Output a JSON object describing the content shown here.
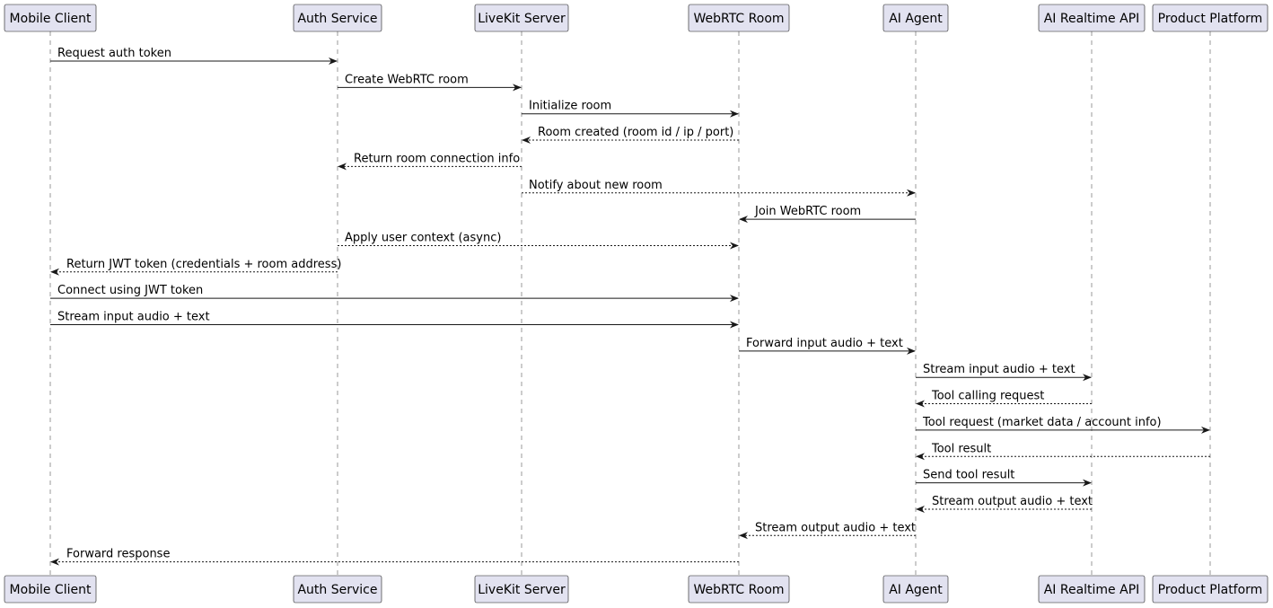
{
  "participants": [
    {
      "id": "mobile",
      "label": "Mobile Client"
    },
    {
      "id": "auth",
      "label": "Auth Service"
    },
    {
      "id": "livekit",
      "label": "LiveKit Server"
    },
    {
      "id": "webrtc",
      "label": "WebRTC Room"
    },
    {
      "id": "agent",
      "label": "AI Agent"
    },
    {
      "id": "realtime",
      "label": "AI Realtime API"
    },
    {
      "id": "product",
      "label": "Product Platform"
    }
  ],
  "messages": [
    {
      "from": "mobile",
      "to": "auth",
      "label": "Request auth token",
      "style": "solid"
    },
    {
      "from": "auth",
      "to": "livekit",
      "label": "Create WebRTC room",
      "style": "solid"
    },
    {
      "from": "livekit",
      "to": "webrtc",
      "label": "Initialize room",
      "style": "solid"
    },
    {
      "from": "webrtc",
      "to": "livekit",
      "label": "Room created (room id / ip / port)",
      "style": "dashed"
    },
    {
      "from": "livekit",
      "to": "auth",
      "label": "Return room connection info",
      "style": "dashed"
    },
    {
      "from": "livekit",
      "to": "agent",
      "label": "Notify about new room",
      "style": "dashed"
    },
    {
      "from": "agent",
      "to": "webrtc",
      "label": "Join WebRTC room",
      "style": "solid"
    },
    {
      "from": "auth",
      "to": "webrtc",
      "label": "Apply user context (async)",
      "style": "dashed"
    },
    {
      "from": "auth",
      "to": "mobile",
      "label": "Return JWT token (credentials + room address)",
      "style": "dashed"
    },
    {
      "from": "mobile",
      "to": "webrtc",
      "label": "Connect using JWT token",
      "style": "solid"
    },
    {
      "from": "mobile",
      "to": "webrtc",
      "label": "Stream input audio + text",
      "style": "solid"
    },
    {
      "from": "webrtc",
      "to": "agent",
      "label": "Forward input audio + text",
      "style": "solid"
    },
    {
      "from": "agent",
      "to": "realtime",
      "label": "Stream input audio + text",
      "style": "solid"
    },
    {
      "from": "realtime",
      "to": "agent",
      "label": "Tool calling request",
      "style": "dashed"
    },
    {
      "from": "agent",
      "to": "product",
      "label": "Tool request (market data / account info)",
      "style": "solid"
    },
    {
      "from": "product",
      "to": "agent",
      "label": "Tool result",
      "style": "dashed"
    },
    {
      "from": "agent",
      "to": "realtime",
      "label": "Send tool result",
      "style": "solid"
    },
    {
      "from": "realtime",
      "to": "agent",
      "label": "Stream output audio + text",
      "style": "dashed"
    },
    {
      "from": "agent",
      "to": "webrtc",
      "label": "Stream output audio + text",
      "style": "dashed"
    },
    {
      "from": "webrtc",
      "to": "mobile",
      "label": "Forward response",
      "style": "dashed"
    }
  ]
}
